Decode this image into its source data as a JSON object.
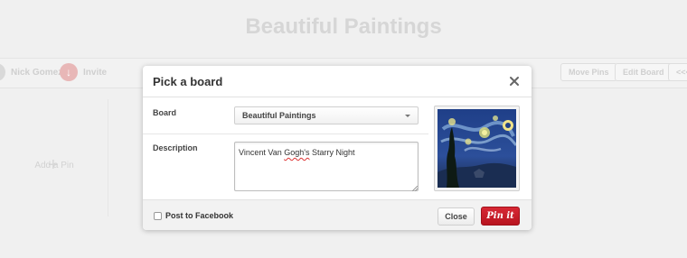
{
  "background": {
    "page_title": "Beautiful Paintings",
    "user_name": "Nick Gomez",
    "invite_label": "Invite",
    "buttons": [
      "Move Pins",
      "Edit Board",
      "<<<"
    ],
    "add_pin_label": "Add a Pin"
  },
  "modal": {
    "title": "Pick a board",
    "board_label": "Board",
    "board_selected": "Beautiful Paintings",
    "description_label": "Description",
    "description_before": "Vincent Van ",
    "description_misspelled": "Gogh's",
    "description_after": " Starry Night",
    "post_to_facebook_label": "Post to Facebook",
    "post_to_facebook_checked": false,
    "close_button_label": "Close",
    "pin_button_label": "Pin it",
    "image_subject": "starry-night-painting"
  },
  "colors": {
    "pin_button": "#cb2027",
    "overlay_bg": "#f0f0f0"
  }
}
